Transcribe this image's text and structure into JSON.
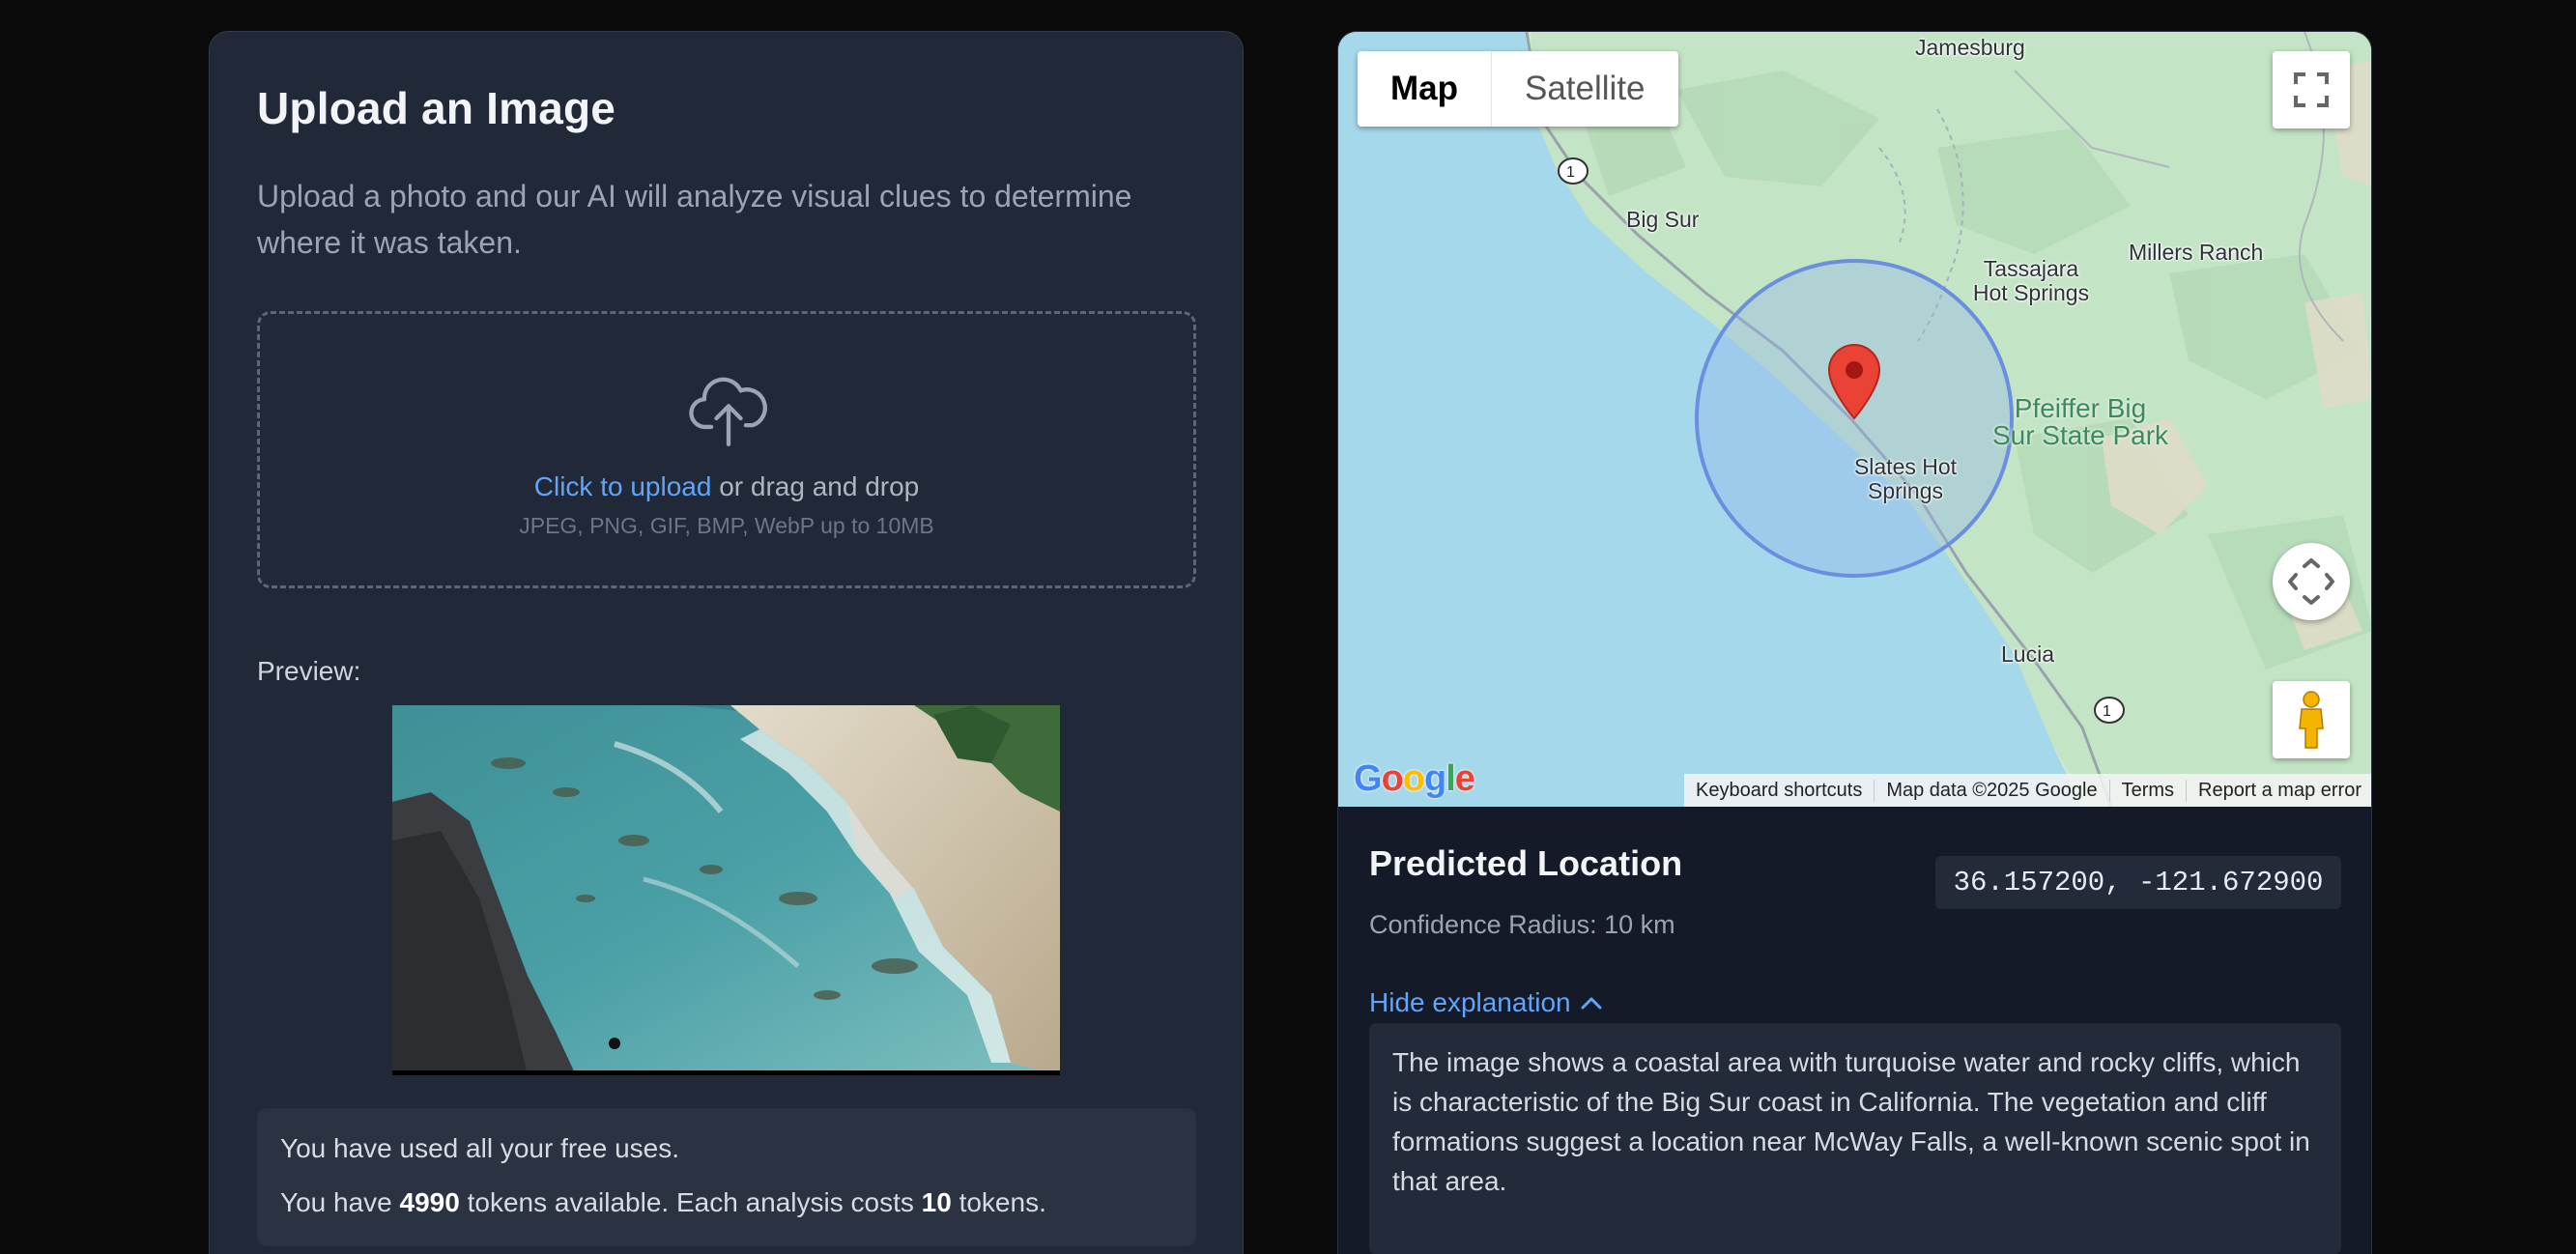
{
  "upload": {
    "title": "Upload an Image",
    "description": "Upload a photo and our AI will analyze visual clues to determine where it was taken.",
    "dropzone": {
      "link_text": "Click to upload",
      "rest_text": " or drag and drop",
      "formats": "JPEG, PNG, GIF, BMP, WebP up to 10MB"
    },
    "preview_label": "Preview:",
    "usage": {
      "free_uses_text": "You have used all your free uses.",
      "tokens_prefix": "You have ",
      "tokens_count": "4990",
      "tokens_middle": " tokens available. Each analysis costs ",
      "cost_count": "10",
      "tokens_suffix": " tokens."
    }
  },
  "map": {
    "type_buttons": {
      "map": "Map",
      "satellite": "Satellite"
    },
    "active_type": "Map",
    "labels": {
      "jamesburg": "Jamesburg",
      "big_sur": "Big Sur",
      "millers_ranch": "Millers Ranch",
      "tassajara_1": "Tassajara",
      "tassajara_2": "Hot Springs",
      "pfeiffer_1": "Pfeiffer Big",
      "pfeiffer_2": "Sur State Park",
      "slates_1": "Slates Hot",
      "slates_2": "Springs",
      "lucia": "Lucia",
      "route_1a": "1",
      "route_1b": "1"
    },
    "attribution": {
      "keyboard": "Keyboard shortcuts",
      "data": "Map data ©2025 Google",
      "terms": "Terms",
      "report": "Report a map error"
    },
    "logo": "Google",
    "colors": {
      "water": "#a7d8eb",
      "land": "#cde9cf",
      "marker": "#ea4335",
      "radius_circle": "#6b8fdf"
    }
  },
  "prediction": {
    "title": "Predicted Location",
    "radius": "Confidence Radius: 10 km",
    "coordinates": "36.157200, -121.672900",
    "toggle": "Hide explanation",
    "explanation": "The image shows a coastal area with turquoise water and rocky cliffs, which is characteristic of the Big Sur coast in California. The vegetation and cliff formations suggest a location near McWay Falls, a well-known scenic spot in that area."
  }
}
